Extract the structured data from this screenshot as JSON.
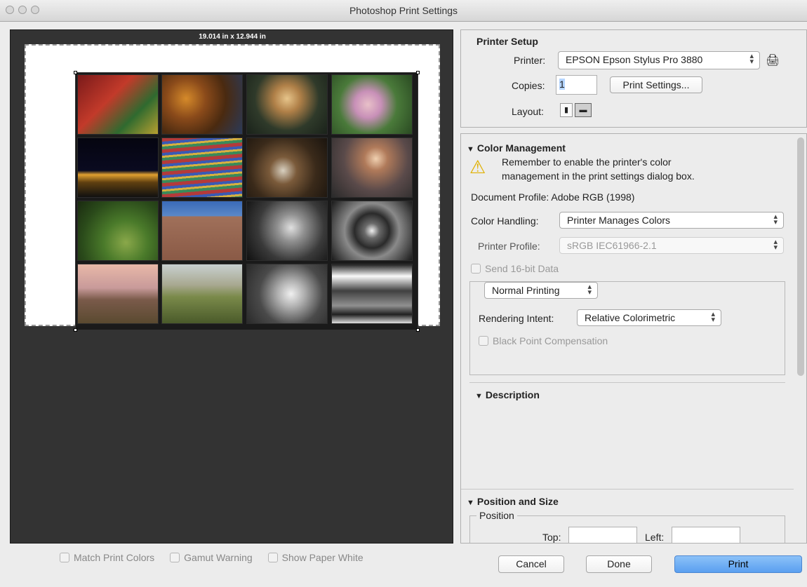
{
  "window": {
    "title": "Photoshop Print Settings"
  },
  "preview": {
    "dimensions": "19.014 in x 12.944 in",
    "match_print_colors": "Match Print Colors",
    "gamut_warning": "Gamut Warning",
    "show_paper_white": "Show Paper White"
  },
  "printer_setup": {
    "header": "Printer Setup",
    "printer_label": "Printer:",
    "printer_value": "EPSON Epson Stylus Pro 3880",
    "copies_label": "Copies:",
    "copies_value": "1",
    "print_settings_button": "Print Settings...",
    "layout_label": "Layout:"
  },
  "color_management": {
    "header": "Color Management",
    "warning_line1": "Remember to enable the printer's color",
    "warning_line2": "management in the print settings dialog box.",
    "document_profile": "Document Profile: Adobe RGB (1998)",
    "color_handling_label": "Color Handling:",
    "color_handling_value": "Printer Manages Colors",
    "printer_profile_label": "Printer Profile:",
    "printer_profile_value": "sRGB IEC61966-2.1",
    "send_16bit": "Send 16-bit Data",
    "printing_mode": "Normal Printing",
    "rendering_intent_label": "Rendering Intent:",
    "rendering_intent_value": "Relative Colorimetric",
    "black_point": "Black Point Compensation"
  },
  "description": {
    "header": "Description"
  },
  "position_size": {
    "header": "Position and Size",
    "position_label": "Position",
    "top_label": "Top:",
    "left_label": "Left:"
  },
  "footer": {
    "cancel": "Cancel",
    "done": "Done",
    "print": "Print"
  },
  "colors": {
    "preview_bg": "#333333",
    "print_button": "#6aa8f2"
  }
}
